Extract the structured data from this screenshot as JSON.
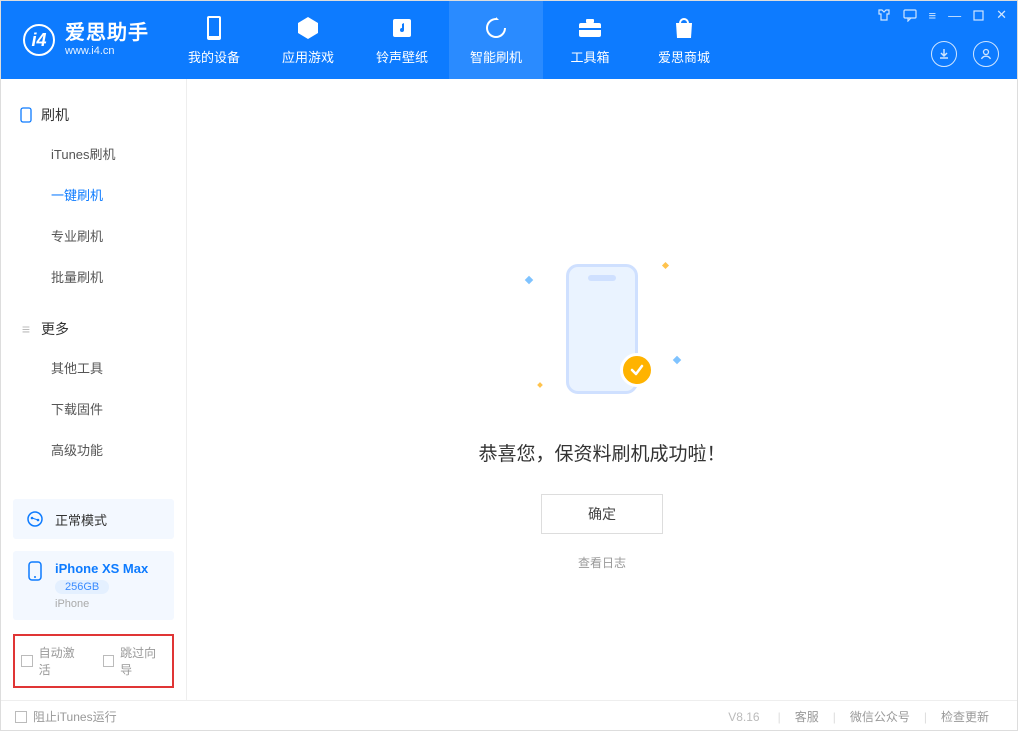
{
  "app": {
    "name_cn": "爱思助手",
    "name_en": "www.i4.cn",
    "logo_letter": "i4"
  },
  "topTabs": [
    {
      "label": "我的设备",
      "icon": "device-icon"
    },
    {
      "label": "应用游戏",
      "icon": "cube-icon"
    },
    {
      "label": "铃声壁纸",
      "icon": "music-icon"
    },
    {
      "label": "智能刷机",
      "icon": "refresh-icon",
      "active": true
    },
    {
      "label": "工具箱",
      "icon": "toolbox-icon"
    },
    {
      "label": "爱思商城",
      "icon": "bag-icon"
    }
  ],
  "sidebar": {
    "group1_title": "刷机",
    "group1_items": [
      "iTunes刷机",
      "一键刷机",
      "专业刷机",
      "批量刷机"
    ],
    "group1_active_index": 1,
    "group2_title": "更多",
    "group2_items": [
      "其他工具",
      "下载固件",
      "高级功能"
    ]
  },
  "mode": {
    "label": "正常模式"
  },
  "device": {
    "name": "iPhone XS Max",
    "capacity": "256GB",
    "type": "iPhone"
  },
  "options": {
    "auto_activate": "自动激活",
    "skip_guide": "跳过向导"
  },
  "main": {
    "success_text": "恭喜您，保资料刷机成功啦！",
    "confirm": "确定",
    "view_log": "查看日志"
  },
  "footer": {
    "block_itunes": "阻止iTunes运行",
    "version": "V8.16",
    "links": [
      "客服",
      "微信公众号",
      "检查更新"
    ]
  }
}
